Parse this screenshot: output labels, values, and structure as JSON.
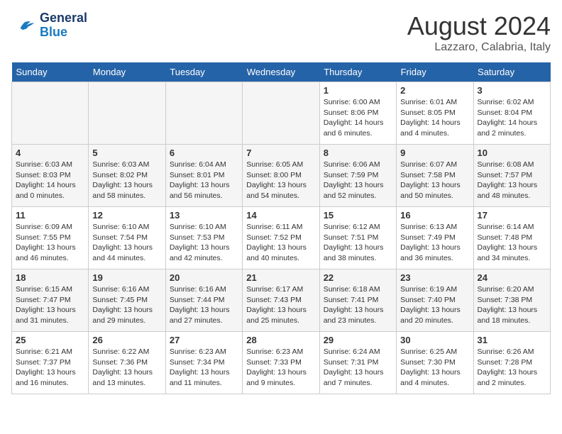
{
  "header": {
    "logo_line1": "General",
    "logo_line2": "Blue",
    "month_title": "August 2024",
    "subtitle": "Lazzaro, Calabria, Italy"
  },
  "weekdays": [
    "Sunday",
    "Monday",
    "Tuesday",
    "Wednesday",
    "Thursday",
    "Friday",
    "Saturday"
  ],
  "weeks": [
    [
      {
        "day": "",
        "info": ""
      },
      {
        "day": "",
        "info": ""
      },
      {
        "day": "",
        "info": ""
      },
      {
        "day": "",
        "info": ""
      },
      {
        "day": "1",
        "info": "Sunrise: 6:00 AM\nSunset: 8:06 PM\nDaylight: 14 hours\nand 6 minutes."
      },
      {
        "day": "2",
        "info": "Sunrise: 6:01 AM\nSunset: 8:05 PM\nDaylight: 14 hours\nand 4 minutes."
      },
      {
        "day": "3",
        "info": "Sunrise: 6:02 AM\nSunset: 8:04 PM\nDaylight: 14 hours\nand 2 minutes."
      }
    ],
    [
      {
        "day": "4",
        "info": "Sunrise: 6:03 AM\nSunset: 8:03 PM\nDaylight: 14 hours\nand 0 minutes."
      },
      {
        "day": "5",
        "info": "Sunrise: 6:03 AM\nSunset: 8:02 PM\nDaylight: 13 hours\nand 58 minutes."
      },
      {
        "day": "6",
        "info": "Sunrise: 6:04 AM\nSunset: 8:01 PM\nDaylight: 13 hours\nand 56 minutes."
      },
      {
        "day": "7",
        "info": "Sunrise: 6:05 AM\nSunset: 8:00 PM\nDaylight: 13 hours\nand 54 minutes."
      },
      {
        "day": "8",
        "info": "Sunrise: 6:06 AM\nSunset: 7:59 PM\nDaylight: 13 hours\nand 52 minutes."
      },
      {
        "day": "9",
        "info": "Sunrise: 6:07 AM\nSunset: 7:58 PM\nDaylight: 13 hours\nand 50 minutes."
      },
      {
        "day": "10",
        "info": "Sunrise: 6:08 AM\nSunset: 7:57 PM\nDaylight: 13 hours\nand 48 minutes."
      }
    ],
    [
      {
        "day": "11",
        "info": "Sunrise: 6:09 AM\nSunset: 7:55 PM\nDaylight: 13 hours\nand 46 minutes."
      },
      {
        "day": "12",
        "info": "Sunrise: 6:10 AM\nSunset: 7:54 PM\nDaylight: 13 hours\nand 44 minutes."
      },
      {
        "day": "13",
        "info": "Sunrise: 6:10 AM\nSunset: 7:53 PM\nDaylight: 13 hours\nand 42 minutes."
      },
      {
        "day": "14",
        "info": "Sunrise: 6:11 AM\nSunset: 7:52 PM\nDaylight: 13 hours\nand 40 minutes."
      },
      {
        "day": "15",
        "info": "Sunrise: 6:12 AM\nSunset: 7:51 PM\nDaylight: 13 hours\nand 38 minutes."
      },
      {
        "day": "16",
        "info": "Sunrise: 6:13 AM\nSunset: 7:49 PM\nDaylight: 13 hours\nand 36 minutes."
      },
      {
        "day": "17",
        "info": "Sunrise: 6:14 AM\nSunset: 7:48 PM\nDaylight: 13 hours\nand 34 minutes."
      }
    ],
    [
      {
        "day": "18",
        "info": "Sunrise: 6:15 AM\nSunset: 7:47 PM\nDaylight: 13 hours\nand 31 minutes."
      },
      {
        "day": "19",
        "info": "Sunrise: 6:16 AM\nSunset: 7:45 PM\nDaylight: 13 hours\nand 29 minutes."
      },
      {
        "day": "20",
        "info": "Sunrise: 6:16 AM\nSunset: 7:44 PM\nDaylight: 13 hours\nand 27 minutes."
      },
      {
        "day": "21",
        "info": "Sunrise: 6:17 AM\nSunset: 7:43 PM\nDaylight: 13 hours\nand 25 minutes."
      },
      {
        "day": "22",
        "info": "Sunrise: 6:18 AM\nSunset: 7:41 PM\nDaylight: 13 hours\nand 23 minutes."
      },
      {
        "day": "23",
        "info": "Sunrise: 6:19 AM\nSunset: 7:40 PM\nDaylight: 13 hours\nand 20 minutes."
      },
      {
        "day": "24",
        "info": "Sunrise: 6:20 AM\nSunset: 7:38 PM\nDaylight: 13 hours\nand 18 minutes."
      }
    ],
    [
      {
        "day": "25",
        "info": "Sunrise: 6:21 AM\nSunset: 7:37 PM\nDaylight: 13 hours\nand 16 minutes."
      },
      {
        "day": "26",
        "info": "Sunrise: 6:22 AM\nSunset: 7:36 PM\nDaylight: 13 hours\nand 13 minutes."
      },
      {
        "day": "27",
        "info": "Sunrise: 6:23 AM\nSunset: 7:34 PM\nDaylight: 13 hours\nand 11 minutes."
      },
      {
        "day": "28",
        "info": "Sunrise: 6:23 AM\nSunset: 7:33 PM\nDaylight: 13 hours\nand 9 minutes."
      },
      {
        "day": "29",
        "info": "Sunrise: 6:24 AM\nSunset: 7:31 PM\nDaylight: 13 hours\nand 7 minutes."
      },
      {
        "day": "30",
        "info": "Sunrise: 6:25 AM\nSunset: 7:30 PM\nDaylight: 13 hours\nand 4 minutes."
      },
      {
        "day": "31",
        "info": "Sunrise: 6:26 AM\nSunset: 7:28 PM\nDaylight: 13 hours\nand 2 minutes."
      }
    ]
  ]
}
